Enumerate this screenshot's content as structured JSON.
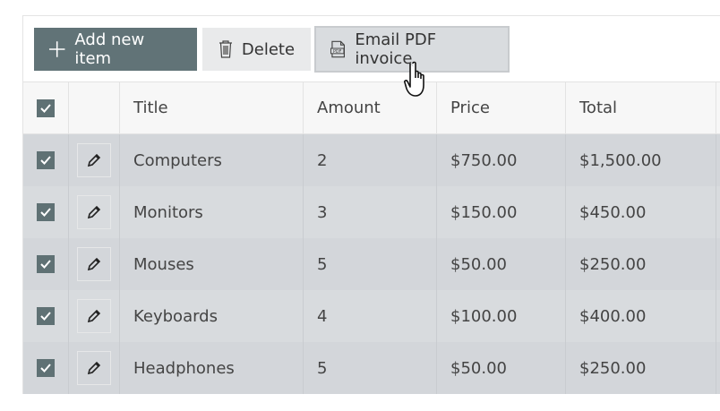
{
  "toolbar": {
    "add_label": "Add new item",
    "delete_label": "Delete",
    "email_label": "Email PDF invoice"
  },
  "table": {
    "columns": [
      "Title",
      "Amount",
      "Price",
      "Total"
    ],
    "rows": [
      {
        "title": "Computers",
        "amount": "2",
        "price": "$750.00",
        "total": "$1,500.00"
      },
      {
        "title": "Monitors",
        "amount": "3",
        "price": "$150.00",
        "total": "$450.00"
      },
      {
        "title": "Mouses",
        "amount": "5",
        "price": "$50.00",
        "total": "$250.00"
      },
      {
        "title": "Keyboards",
        "amount": "4",
        "price": "$100.00",
        "total": "$400.00"
      },
      {
        "title": "Headphones",
        "amount": "5",
        "price": "$50.00",
        "total": "$250.00"
      }
    ]
  },
  "colors": {
    "primary": "#617377",
    "checkbox": "#5f7174",
    "row_selected": "#d8dbde"
  }
}
